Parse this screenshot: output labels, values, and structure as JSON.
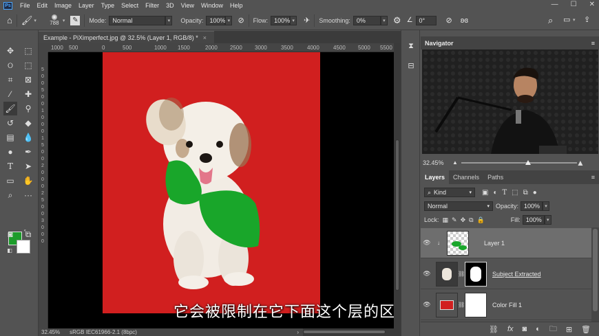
{
  "menu": [
    "File",
    "Edit",
    "Image",
    "Layer",
    "Type",
    "Select",
    "Filter",
    "3D",
    "View",
    "Window",
    "Help"
  ],
  "window_controls": [
    "—",
    "☐",
    "✕"
  ],
  "options": {
    "brush_size": "788",
    "mode_label": "Mode:",
    "mode_value": "Normal",
    "opacity_label": "Opacity:",
    "opacity_value": "100%",
    "flow_label": "Flow:",
    "flow_value": "100%",
    "smoothing_label": "Smoothing:",
    "smoothing_value": "0%",
    "angle_value": "0°"
  },
  "document": {
    "tab_title": "Example - PiXimperfect.jpg @ 32.5% (Layer 1, RGB/8) *",
    "close": "×",
    "ruler_top": [
      "1000",
      "500",
      "0",
      "500",
      "1000",
      "1500",
      "2000",
      "2500",
      "3000",
      "3500",
      "4000",
      "4500",
      "5000",
      "5500"
    ],
    "ruler_left": [
      "5",
      "0",
      "0",
      "5",
      "0",
      "0",
      "1",
      "0",
      "0",
      "0",
      "1",
      "5",
      "0",
      "0",
      "2",
      "0",
      "0",
      "0",
      "2",
      "5",
      "0",
      "0",
      "3",
      "0",
      "0",
      "0"
    ]
  },
  "subtitle": "它会被限制在它下面这个层的区域",
  "status": {
    "zoom": "32.45%",
    "profile": "sRGB IEC61966-2.1 (8bpc)"
  },
  "navigator": {
    "title": "Navigator",
    "zoom": "32.45%",
    "slider_level": 0.58
  },
  "layers_panel": {
    "tabs": [
      "Layers",
      "Channels",
      "Paths"
    ],
    "kind_label": "Kind",
    "blend_mode": "Normal",
    "opacity_label": "Opacity:",
    "opacity_value": "100%",
    "lock_label": "Lock:",
    "fill_label": "Fill:",
    "fill_value": "100%",
    "layers": [
      {
        "name": "Layer 1",
        "selected": true
      },
      {
        "name": "Subject Extracted",
        "selected": false
      },
      {
        "name": "Color Fill 1",
        "selected": false
      }
    ]
  },
  "colors": {
    "foreground": "#1c9c2a",
    "background": "#ffffff",
    "doc_background": "#d11f1f"
  }
}
